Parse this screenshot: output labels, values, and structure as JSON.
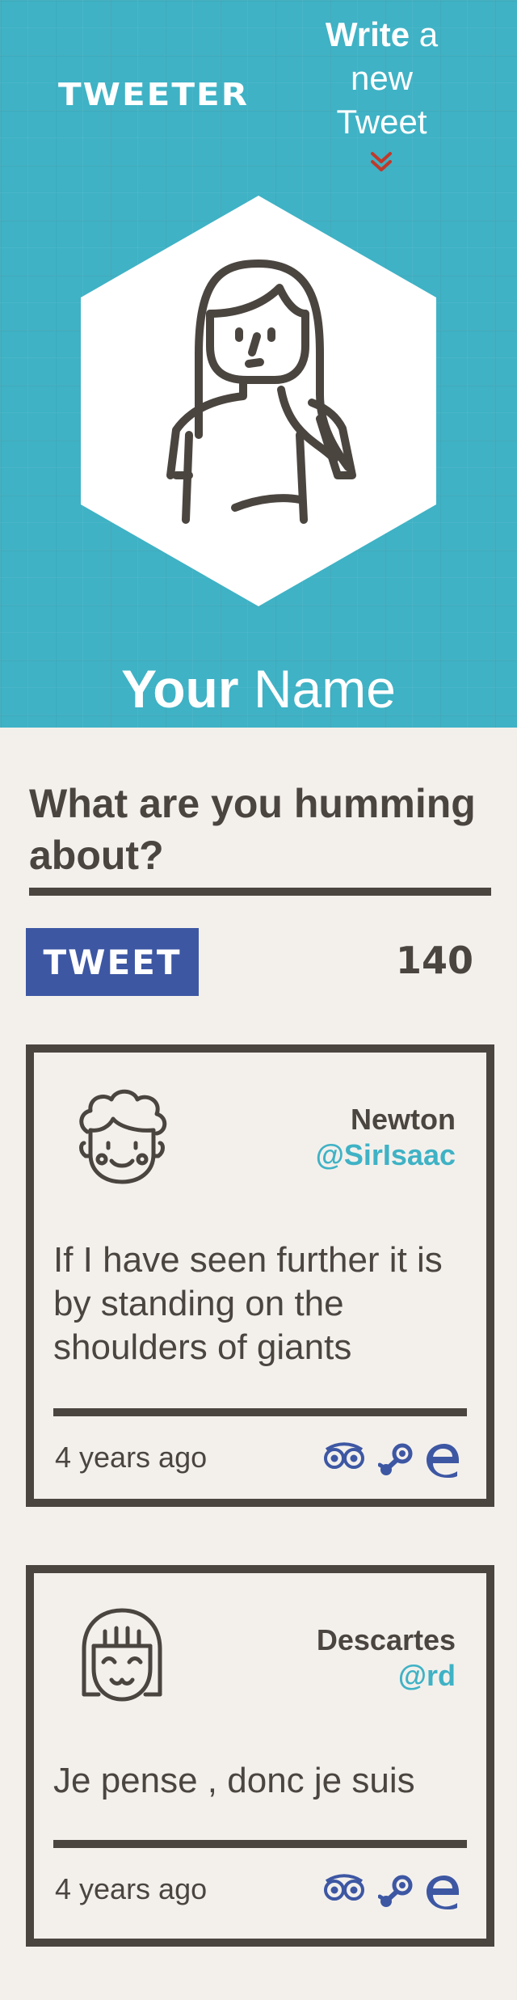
{
  "app": {
    "logo": "TWEETER",
    "write_link": {
      "strong": "Write",
      "rest": " a new Tweet"
    }
  },
  "profile": {
    "name_strong": "Your",
    "name_light": " Name"
  },
  "compose": {
    "prompt": "What are you humming about?",
    "tweet_button": "TWEET",
    "char_count": "140"
  },
  "colors": {
    "header_bg": "#3fb2c5",
    "page_bg": "#f3f0ec",
    "text_dark": "#4b4540",
    "button_blue": "#3d57a3",
    "handle_teal": "#3fb2c5",
    "chevron_red": "#c0392b"
  },
  "tweets": [
    {
      "name": "Newton",
      "handle": "@SirIsaac",
      "text": "If I have seen further it is by standing on the shoulders of giants",
      "time": "4 years ago",
      "avatar_icon": "curly-hair-man-icon"
    },
    {
      "name": "Descartes",
      "handle": "@rd",
      "text": "Je pense , donc je suis",
      "time": "4 years ago",
      "avatar_icon": "bob-hair-woman-icon"
    }
  ],
  "action_icons": [
    "tripadvisor-icon",
    "steam-icon",
    "edge-icon"
  ]
}
